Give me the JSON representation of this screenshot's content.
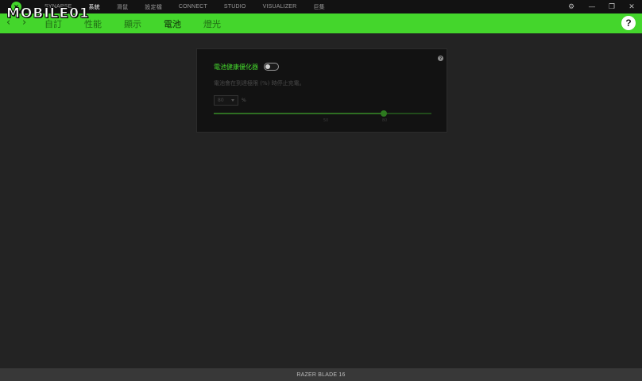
{
  "titlebar": {
    "nav": [
      {
        "label": "SYNAPSE",
        "active": false
      },
      {
        "label": "系統",
        "active": true
      },
      {
        "label": "滑鼠",
        "active": false
      },
      {
        "label": "設定檔",
        "active": false
      },
      {
        "label": "CONNECT",
        "active": false
      },
      {
        "label": "STUDIO",
        "active": false
      },
      {
        "label": "VISUALIZER",
        "active": false
      },
      {
        "label": "巨集",
        "active": false
      }
    ],
    "controls": {
      "settings": "⚙",
      "minimize": "—",
      "restore": "❐",
      "close": "✕"
    }
  },
  "watermark": {
    "text": "MOBILE01"
  },
  "subnav": {
    "back": "‹",
    "forward": "›",
    "tabs": [
      {
        "label": "自訂",
        "active": false
      },
      {
        "label": "性能",
        "active": false
      },
      {
        "label": "顯示",
        "active": false
      },
      {
        "label": "電池",
        "active": true
      },
      {
        "label": "燈光",
        "active": false
      }
    ],
    "help": "?"
  },
  "battery_card": {
    "help": "?",
    "title": "電池健康優化器",
    "toggle_on": false,
    "description": "電池會在到達極限 (%) 時停止充電。",
    "limit_value": "80",
    "unit": "%",
    "slider": {
      "min": 50,
      "max": 80,
      "value": 80,
      "fill_fraction": 0.78
    },
    "tick_labels": [
      "50",
      "80"
    ]
  },
  "footer": {
    "device": "RAZER BLADE 16"
  },
  "colors": {
    "accent": "#44d62c",
    "background": "#232323",
    "card": "#121212"
  }
}
